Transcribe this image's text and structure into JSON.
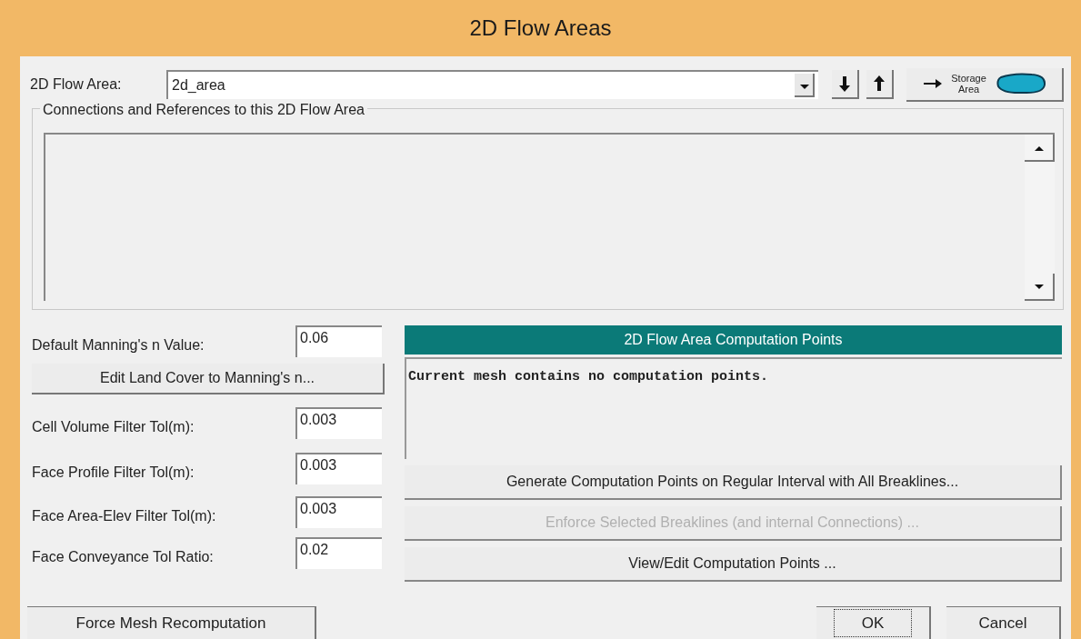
{
  "window": {
    "title": "2D Flow Areas"
  },
  "flow_area": {
    "label": "2D Flow Area:",
    "value": "2d_area"
  },
  "storage_button": {
    "label": "Storage Area"
  },
  "connections": {
    "title": "Connections and References to this 2D Flow Area"
  },
  "manning": {
    "label": "Default Manning's n Value:",
    "value": "0.06",
    "button": "Edit Land Cover to Manning's n..."
  },
  "tolerances": [
    {
      "label": "Cell Volume Filter Tol(m):",
      "value": "0.003"
    },
    {
      "label": "Face Profile Filter Tol(m):",
      "value": "0.003"
    },
    {
      "label": "Face Area-Elev Filter Tol(m):",
      "value": "0.003"
    },
    {
      "label": "Face Conveyance Tol Ratio:",
      "value": "0.02"
    }
  ],
  "computation_points": {
    "header": "2D Flow Area Computation Points",
    "text": "Current mesh contains no computation points.",
    "buttons": [
      {
        "label": "Generate Computation Points on Regular Interval with All Breaklines...",
        "disabled": false
      },
      {
        "label": "Enforce Selected Breaklines (and internal Connections) ...",
        "disabled": true
      },
      {
        "label": "View/Edit Computation Points ...",
        "disabled": false
      }
    ]
  },
  "force_button": {
    "label": "Force Mesh Recomputation"
  },
  "dialog_buttons": [
    {
      "label": "OK",
      "focused": true
    },
    {
      "label": "Cancel",
      "focused": false
    }
  ]
}
